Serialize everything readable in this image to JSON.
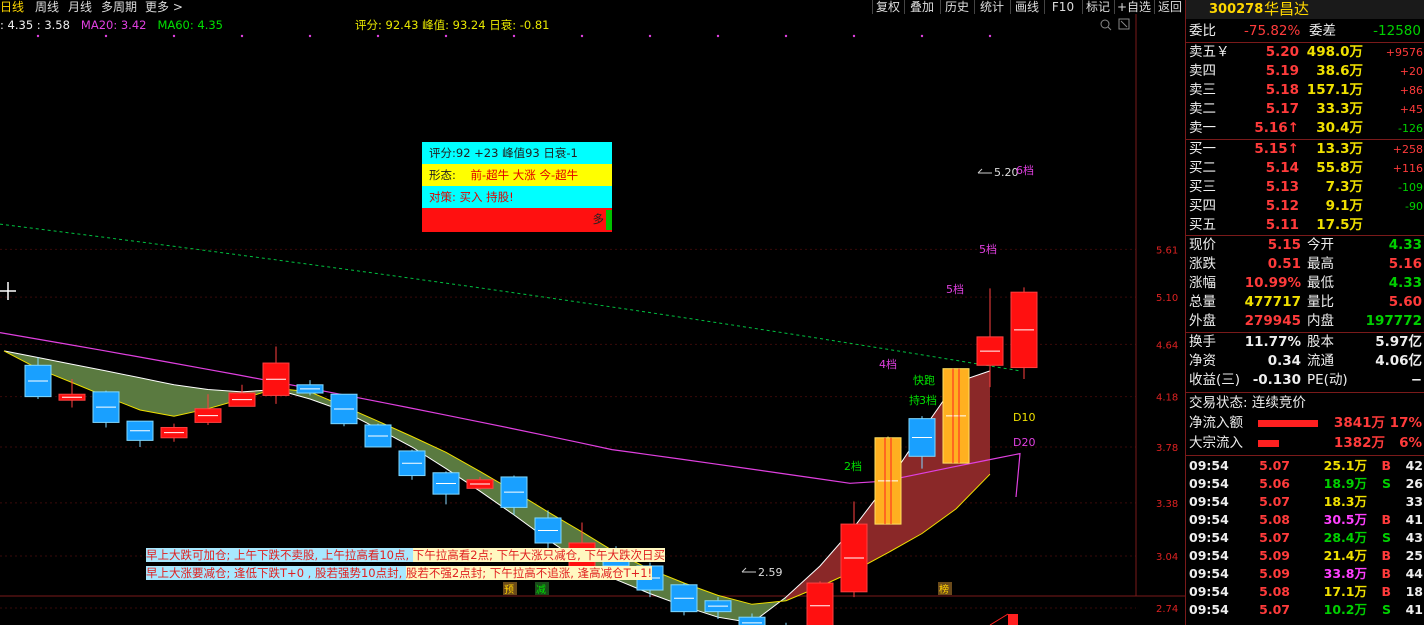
{
  "top_tabs": [
    "日线",
    "周线",
    "月线",
    "多周期",
    "更多 >"
  ],
  "toolbar": {
    "items": [
      "复权",
      "叠加",
      "历史",
      "统计",
      "画线",
      "F10",
      "标记",
      "+自选",
      "返回"
    ]
  },
  "ma_line": {
    "ma5": ": 4.35 : 3.58",
    "ma20": "MA20: 3.42",
    "ma60": "MA60: 4.35"
  },
  "score_line": "评分: 92.43  峰值: 93.24  日衰: -0.81",
  "infobox": {
    "row1": "评分:92  +23   峰值93   日衰-1",
    "row2_label": "形态:",
    "row2_value": "前-超牛   大涨   今-超牛",
    "row3": "对策: 买入       持股!",
    "row4": "多"
  },
  "tips": {
    "line1_a": "早上大跌可加仓; 上午下跌不卖股, 上午拉高看10点, ",
    "line1_b": "下午拉高看2点; 下午大涨只减仓, 下午大跌次日买",
    "line2_a": "早上大涨要减仓; 逢低下跌T+0  , 股若强势10点封, ",
    "line2_b": "股若不强2点封; 下午拉高不追涨, 逢高减仓T+1!"
  },
  "chart_marks": {
    "low_label": "2.59",
    "high_label": "5.20",
    "stage_labels": [
      "2档",
      "3档",
      "4档",
      "5档",
      "5档",
      "6档"
    ],
    "signal_labels": [
      "快跑",
      "持"
    ],
    "d10": "D10",
    "d20": "D20",
    "bottom_tags": [
      "预",
      "减",
      "榜"
    ]
  },
  "y_axis": {
    "labels": [
      "5.61",
      "5.10",
      "4.64",
      "4.18",
      "3.78",
      "3.38",
      "3.04",
      "2.74"
    ]
  },
  "candles": [
    {
      "o": 4.18,
      "c": 4.45,
      "h": 4.52,
      "l": 4.16,
      "up": false
    },
    {
      "o": 4.15,
      "c": 4.2,
      "h": 4.33,
      "l": 4.09,
      "up": true
    },
    {
      "o": 4.22,
      "c": 3.97,
      "h": 4.23,
      "l": 3.93,
      "up": false
    },
    {
      "o": 3.98,
      "c": 3.83,
      "h": 3.98,
      "l": 3.78,
      "up": false
    },
    {
      "o": 3.85,
      "c": 3.93,
      "h": 3.96,
      "l": 3.82,
      "up": true
    },
    {
      "o": 3.97,
      "c": 4.08,
      "h": 4.2,
      "l": 3.95,
      "up": true
    },
    {
      "o": 4.1,
      "c": 4.21,
      "h": 4.28,
      "l": 4.1,
      "up": true
    },
    {
      "o": 4.19,
      "c": 4.47,
      "h": 4.62,
      "l": 4.12,
      "up": true
    },
    {
      "o": 4.28,
      "c": 4.21,
      "h": 4.32,
      "l": 4.19,
      "up": false
    },
    {
      "o": 4.2,
      "c": 3.96,
      "h": 4.2,
      "l": 3.94,
      "up": false
    },
    {
      "o": 3.95,
      "c": 3.78,
      "h": 3.96,
      "l": 3.78,
      "up": false
    },
    {
      "o": 3.75,
      "c": 3.57,
      "h": 3.76,
      "l": 3.54,
      "up": false
    },
    {
      "o": 3.59,
      "c": 3.44,
      "h": 3.6,
      "l": 3.37,
      "up": false
    },
    {
      "o": 3.54,
      "c": 3.48,
      "h": 3.56,
      "l": 3.47,
      "up": true
    },
    {
      "o": 3.56,
      "c": 3.35,
      "h": 3.57,
      "l": 3.3,
      "up": false
    },
    {
      "o": 3.28,
      "c": 3.12,
      "h": 3.33,
      "l": 3.08,
      "up": false
    },
    {
      "o": 2.94,
      "c": 3.12,
      "h": 3.25,
      "l": 2.94,
      "up": true
    },
    {
      "o": 3.06,
      "c": 2.98,
      "h": 3.1,
      "l": 2.96,
      "up": false
    },
    {
      "o": 2.98,
      "c": 2.84,
      "h": 3.0,
      "l": 2.8,
      "up": false
    },
    {
      "o": 2.87,
      "c": 2.72,
      "h": 2.88,
      "l": 2.7,
      "up": false
    },
    {
      "o": 2.78,
      "c": 2.72,
      "h": 2.8,
      "l": 2.68,
      "up": false
    },
    {
      "o": 2.69,
      "c": 2.63,
      "h": 2.71,
      "l": 2.59,
      "up": false
    },
    {
      "o": 2.64,
      "c": 2.61,
      "h": 2.66,
      "l": 2.59,
      "up": false
    },
    {
      "o": 2.63,
      "c": 2.88,
      "h": 2.89,
      "l": 2.63,
      "up": true
    },
    {
      "o": 2.83,
      "c": 3.24,
      "h": 3.39,
      "l": 2.8,
      "up": true
    },
    {
      "o": 3.24,
      "c": 3.85,
      "h": 3.86,
      "l": 3.24,
      "up": true,
      "gold": true
    },
    {
      "o": 4.0,
      "c": 3.71,
      "h": 4.02,
      "l": 3.62,
      "up": false
    },
    {
      "o": 3.66,
      "c": 4.42,
      "h": 4.42,
      "l": 3.66,
      "up": true,
      "gold": true
    },
    {
      "o": 4.45,
      "c": 4.71,
      "h": 5.19,
      "l": 4.26,
      "up": true
    },
    {
      "o": 4.43,
      "c": 5.15,
      "h": 5.2,
      "l": 4.33,
      "up": true
    }
  ],
  "stock": {
    "code": "300278",
    "name": "华昌达"
  },
  "weibi": {
    "label1": "委比",
    "val1": "-75.82%",
    "label2": "委差",
    "val2": "-12580"
  },
  "sell_orders": [
    {
      "label": "卖五￥",
      "price": "5.20",
      "vol": "498.0万",
      "chg": "+9576"
    },
    {
      "label": "卖四",
      "price": "5.19",
      "vol": "38.6万",
      "chg": "+20"
    },
    {
      "label": "卖三",
      "price": "5.18",
      "vol": "157.1万",
      "chg": "+86"
    },
    {
      "label": "卖二",
      "price": "5.17",
      "vol": "33.3万",
      "chg": "+45"
    },
    {
      "label": "卖一",
      "price": "5.16↑",
      "vol": "30.4万",
      "chg": "-126"
    }
  ],
  "buy_orders": [
    {
      "label": "买一",
      "price": "5.15↑",
      "vol": "13.3万",
      "chg": "+258"
    },
    {
      "label": "买二",
      "price": "5.14",
      "vol": "55.8万",
      "chg": "+116"
    },
    {
      "label": "买三",
      "price": "5.13",
      "vol": "7.3万",
      "chg": "-109"
    },
    {
      "label": "买四",
      "price": "5.12",
      "vol": "9.1万",
      "chg": "-90"
    },
    {
      "label": "买五",
      "price": "5.11",
      "vol": "17.5万",
      "chg": ""
    }
  ],
  "quote": [
    {
      "l1": "现价",
      "v1": "5.15",
      "l2": "今开",
      "v2": "4.33"
    },
    {
      "l1": "涨跌",
      "v1": "0.51",
      "l2": "最高",
      "v2": "5.16"
    },
    {
      "l1": "涨幅",
      "v1": "10.99%",
      "l2": "最低",
      "v2": "4.33"
    },
    {
      "l1": "总量",
      "v1": "477717",
      "l2": "量比",
      "v2": "5.60"
    },
    {
      "l1": "外盘",
      "v1": "279945",
      "l2": "内盘",
      "v2": "197772"
    }
  ],
  "fund": [
    {
      "l1": "换手",
      "v1": "11.77%",
      "l2": "股本",
      "v2": "5.97亿"
    },
    {
      "l1": "净资",
      "v1": "0.34",
      "l2": "流通",
      "v2": "4.06亿"
    },
    {
      "l1": "收益(三)",
      "v1": "-0.130",
      "l2": "PE(动)",
      "v2": "−"
    }
  ],
  "trade_status": "交易状态: 连续竞价",
  "flows": [
    {
      "label": "净流入额",
      "val": "3841万",
      "pct": "17%",
      "bar": 0.85
    },
    {
      "label": "大宗流入",
      "val": "1382万",
      "pct": "6%",
      "bar": 0.3
    }
  ],
  "ticks": [
    {
      "t": "09:54",
      "p": "5.07",
      "v": "25.1万",
      "s": "B",
      "n": "42"
    },
    {
      "t": "09:54",
      "p": "5.06",
      "v": "18.9万",
      "s": "S",
      "n": "26"
    },
    {
      "t": "09:54",
      "p": "5.07",
      "v": "18.3万",
      "s": "",
      "n": "33"
    },
    {
      "t": "09:54",
      "p": "5.08",
      "v": "30.5万",
      "s": "B",
      "n": "41"
    },
    {
      "t": "09:54",
      "p": "5.07",
      "v": "28.4万",
      "s": "S",
      "n": "43"
    },
    {
      "t": "09:54",
      "p": "5.09",
      "v": "21.4万",
      "s": "B",
      "n": "25"
    },
    {
      "t": "09:54",
      "p": "5.09",
      "v": "33.8万",
      "s": "B",
      "n": "44"
    },
    {
      "t": "09:54",
      "p": "5.08",
      "v": "17.1万",
      "s": "B",
      "n": "18"
    },
    {
      "t": "09:54",
      "p": "5.07",
      "v": "10.2万",
      "s": "S",
      "n": "41"
    }
  ],
  "colors": {
    "up": "#ff2020",
    "down_cyan": "#19a0ff",
    "gold": "#ffb020",
    "ma60": "#e040e0",
    "ma20_dash": "#00c040",
    "band_green": "#5a7a40",
    "band_red": "#8a2828"
  }
}
